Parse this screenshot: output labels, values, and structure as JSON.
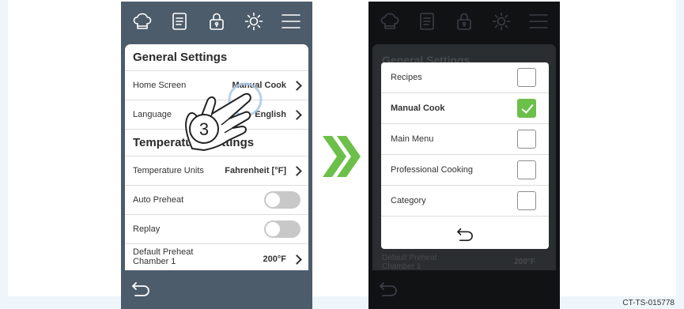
{
  "colors": {
    "left_phone_bg": "#4c5c6b",
    "right_phone_bg": "#101214",
    "accent_green": "#6cc04a"
  },
  "top_icons": [
    "chef-hat-icon",
    "recipe-book-icon",
    "lock-icon",
    "brightness-icon",
    "menu-icon"
  ],
  "left_screen": {
    "title": "General Settings",
    "home_screen_label": "Home Screen",
    "home_screen_value": "Manual Cook",
    "language_label": "Language",
    "language_value": "English",
    "temperature_title": "Temperature Settings",
    "temperature_units_label": "Temperature Units",
    "temperature_units_value": "Fahrenheit [°F]",
    "auto_preheat_label": "Auto Preheat",
    "replay_label": "Replay",
    "default_preheat_label_line1": "Default Preheat",
    "default_preheat_label_line2": "Chamber 1",
    "default_preheat_value": "200°F",
    "step_number": "3"
  },
  "right_screen": {
    "dimmed_title": "General Settings",
    "dimmed_preheat_line1": "Default Preheat",
    "dimmed_preheat_line2": "Chamber 1",
    "dimmed_preheat_value": "200°F",
    "options": [
      {
        "label": "Recipes",
        "checked": false
      },
      {
        "label": "Manual Cook",
        "checked": true
      },
      {
        "label": "Main Menu",
        "checked": false
      },
      {
        "label": "Professional Cooking",
        "checked": false
      },
      {
        "label": "Category",
        "checked": false
      }
    ]
  },
  "doc_code": "CT-TS-015778"
}
